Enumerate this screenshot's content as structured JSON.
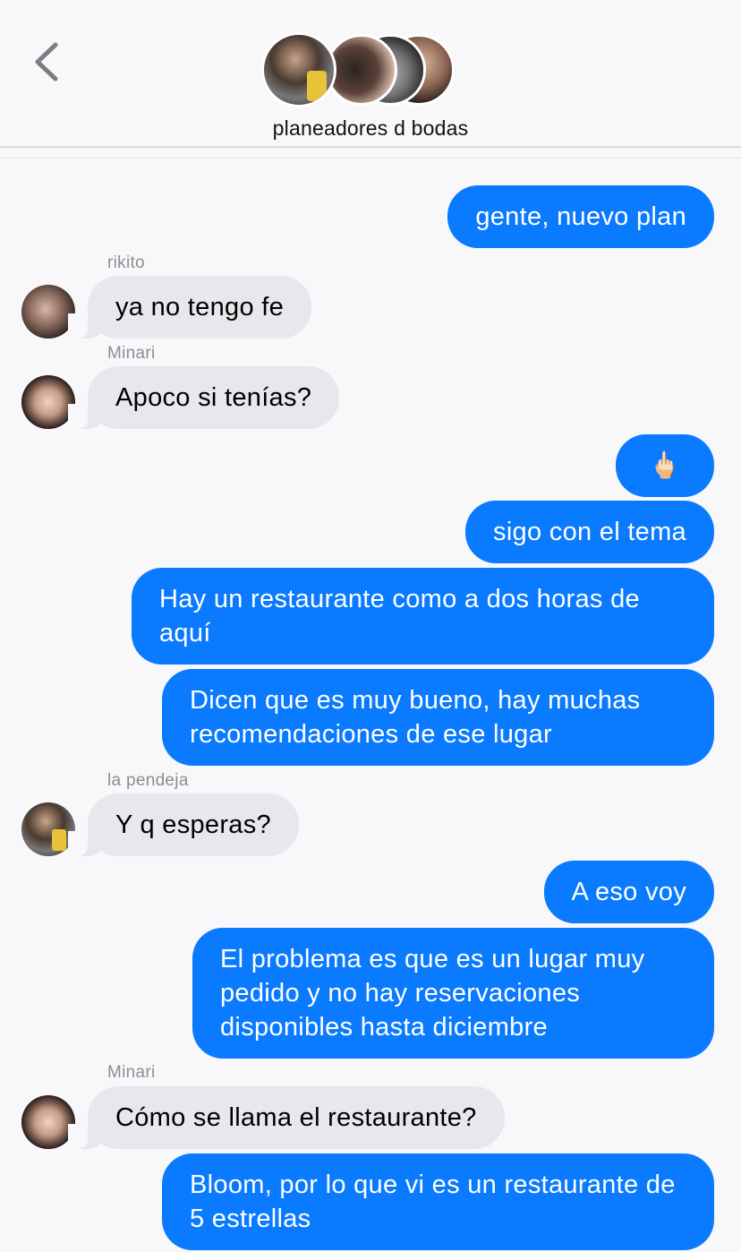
{
  "header": {
    "group_name": "planeadores d bodas",
    "back_icon": "chevron-left-icon",
    "avatar_count": 4
  },
  "colors": {
    "sent_bubble": "#0a7aff",
    "received_bubble": "#e8e7ec",
    "background": "#f8f8fa"
  },
  "messages": [
    {
      "type": "sent",
      "text": "gente, nuevo plan"
    },
    {
      "type": "received",
      "sender": "rikito",
      "text": "ya no tengo fe"
    },
    {
      "type": "received",
      "sender": "Minari",
      "text": "Apoco si tenías?"
    },
    {
      "type": "sent",
      "text": "🖕🏻"
    },
    {
      "type": "sent",
      "text": "sigo con el tema"
    },
    {
      "type": "sent",
      "text": "Hay un restaurante como a dos horas de aquí"
    },
    {
      "type": "sent",
      "text": "Dicen que es muy bueno, hay muchas recomendaciones de ese lugar"
    },
    {
      "type": "received",
      "sender": "la pendeja",
      "text": "Y q esperas?"
    },
    {
      "type": "sent",
      "text": "A eso voy"
    },
    {
      "type": "sent",
      "text": "El problema es que es un lugar muy pedido y no hay reservaciones disponibles hasta diciembre"
    },
    {
      "type": "received",
      "sender": "Minari",
      "text": "Cómo se llama el restaurante?"
    },
    {
      "type": "sent",
      "text": "Bloom, por lo que vi es un restaurante de 5 estrellas"
    }
  ]
}
